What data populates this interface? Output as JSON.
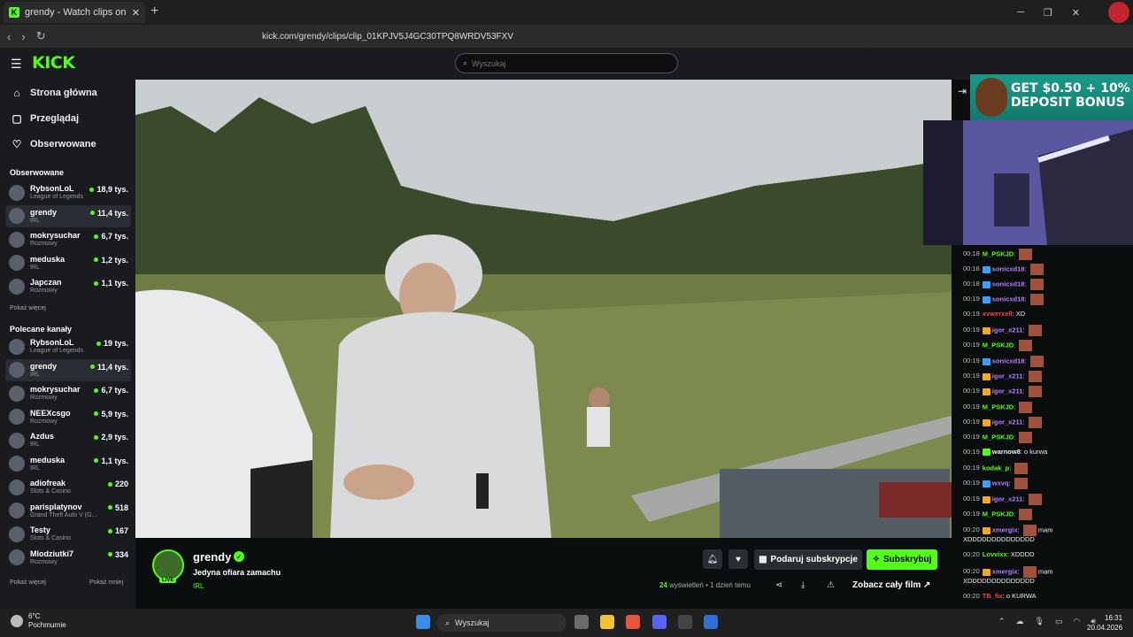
{
  "browser": {
    "tab_title": "grendy - Watch clips on Kick",
    "new_tab": "+",
    "url": "kick.com/grendy/clips/clip_01KPJV5J4GC30TPQ8WRDV53FXV",
    "win_min": "─",
    "win_max": "❐",
    "win_close": "✕"
  },
  "header": {
    "logo": "KICK",
    "search_placeholder": "Wyszukaj"
  },
  "sidebar": {
    "nav": [
      {
        "label": "Strona główna",
        "icon": "home-icon"
      },
      {
        "label": "Przeglądaj",
        "icon": "browse-icon"
      },
      {
        "label": "Obserwowane",
        "icon": "heart-icon"
      }
    ],
    "followed_heading": "Obserwowane",
    "followed": [
      {
        "name": "RybsonLoL",
        "category": "League of Legends",
        "viewers": "18,9 tys."
      },
      {
        "name": "grendy",
        "category": "IRL",
        "viewers": "11,4 tys."
      },
      {
        "name": "mokrysuchar",
        "category": "Rozmowy",
        "viewers": "6,7 tys."
      },
      {
        "name": "meduska",
        "category": "IRL",
        "viewers": "1,2 tys."
      },
      {
        "name": "Japczan",
        "category": "Rozmowy",
        "viewers": "1,1 tys."
      }
    ],
    "followed_more": "Pokaż więcej",
    "recommended_heading": "Polecane kanały",
    "recommended": [
      {
        "name": "RybsonLoL",
        "category": "League of Legends",
        "viewers": "19 tys."
      },
      {
        "name": "grendy",
        "category": "IRL",
        "viewers": "11,4 tys."
      },
      {
        "name": "mokrysuchar",
        "category": "Rozmowy",
        "viewers": "6,7 tys."
      },
      {
        "name": "NEEXcsgo",
        "category": "Rozmowy",
        "viewers": "5,9 tys."
      },
      {
        "name": "Azdus",
        "category": "IRL",
        "viewers": "2,9 tys."
      },
      {
        "name": "meduska",
        "category": "IRL",
        "viewers": "1,1 tys."
      },
      {
        "name": "adiofreak",
        "category": "Slots & Casino",
        "viewers": "220"
      },
      {
        "name": "parisplatynov",
        "category": "Grand Theft Auto V (G...",
        "viewers": "518"
      },
      {
        "name": "Testy",
        "category": "Slots & Casino",
        "viewers": "167"
      },
      {
        "name": "Mlodziutki7",
        "category": "Rozmowy",
        "viewers": "334"
      }
    ],
    "rec_more": "Pokaż więcej",
    "rec_less": "Pokaż mniej"
  },
  "clip": {
    "channel": "grendy",
    "live_badge": "LIVE",
    "verified": "✓",
    "title": "Jedyna ofiara zamachu",
    "category": "IRL",
    "gift_label": "Podaruj subskrypcje",
    "subscribe_label": "Subskrybuj",
    "views_count": "24",
    "views_label": "wyświetleń",
    "age": "• 1 dzień temu",
    "watch_full": "Zobacz cały film"
  },
  "ad": {
    "text": "GET $0.50 + 10% DEPOSIT BONUS"
  },
  "chat": [
    {
      "time": "00:18",
      "user": "M_PSKJD",
      "color": "#53fc18",
      "text": "",
      "emote": true,
      "badge": ""
    },
    {
      "time": "00:18",
      "user": "sonicxd18",
      "color": "#b47cff",
      "text": "",
      "emote": true,
      "badge": "#3aa0ff"
    },
    {
      "time": "00:18",
      "user": "sonicxd18",
      "color": "#b47cff",
      "text": "",
      "emote": true,
      "badge": "#3aa0ff"
    },
    {
      "time": "00:19",
      "user": "sonicxd18",
      "color": "#b47cff",
      "text": "",
      "emote": true,
      "badge": "#3aa0ff"
    },
    {
      "time": "00:19",
      "user": "xvwerxell",
      "color": "#ff4040",
      "text": "XD",
      "emote": false,
      "badge": ""
    },
    {
      "time": "00:19",
      "user": "igor_x211",
      "color": "#b47cff",
      "text": "",
      "emote": true,
      "badge": "#f5a623"
    },
    {
      "time": "00:19",
      "user": "M_PSKJD",
      "color": "#53fc18",
      "text": "",
      "emote": true,
      "badge": ""
    },
    {
      "time": "00:19",
      "user": "sonicxd18",
      "color": "#b47cff",
      "text": "",
      "emote": true,
      "badge": "#3aa0ff"
    },
    {
      "time": "00:19",
      "user": "igor_x211",
      "color": "#b47cff",
      "text": "",
      "emote": true,
      "badge": "#f5a623"
    },
    {
      "time": "00:19",
      "user": "igor_x211",
      "color": "#b47cff",
      "text": "",
      "emote": true,
      "badge": "#f5a623"
    },
    {
      "time": "00:19",
      "user": "M_PSKJD",
      "color": "#53fc18",
      "text": "",
      "emote": true,
      "badge": ""
    },
    {
      "time": "00:19",
      "user": "igor_x211",
      "color": "#b47cff",
      "text": "",
      "emote": true,
      "badge": "#f5a623"
    },
    {
      "time": "00:19",
      "user": "M_PSKJD",
      "color": "#53fc18",
      "text": "",
      "emote": true,
      "badge": ""
    },
    {
      "time": "00:19",
      "user": "warnow8",
      "color": "#eeeeee",
      "text": "o kurwa",
      "emote": false,
      "badge": "#53fc18"
    },
    {
      "time": "00:19",
      "user": "kodak_p",
      "color": "#53fc18",
      "text": "",
      "emote": true,
      "badge": ""
    },
    {
      "time": "00:19",
      "user": "wxvq",
      "color": "#b47cff",
      "text": "",
      "emote": true,
      "badge": "#3aa0ff"
    },
    {
      "time": "00:19",
      "user": "igor_x211",
      "color": "#b47cff",
      "text": "",
      "emote": true,
      "badge": "#f5a623"
    },
    {
      "time": "00:19",
      "user": "M_PSKJD",
      "color": "#53fc18",
      "text": "",
      "emote": true,
      "badge": ""
    },
    {
      "time": "00:20",
      "user": "xmergix",
      "color": "#b47cff",
      "text": "mam",
      "emote": true,
      "badge": "#f5a623"
    },
    {
      "time": "",
      "user": "",
      "color": "#eeeeee",
      "text": "XDDDDDDDDDDDDDD",
      "emote": false,
      "badge": ""
    },
    {
      "time": "00:20",
      "user": "Lovvixx",
      "color": "#53fc18",
      "text": "XDDDD",
      "emote": false,
      "badge": ""
    },
    {
      "time": "00:20",
      "user": "xmergix",
      "color": "#b47cff",
      "text": "mam",
      "emote": true,
      "badge": "#f5a623"
    },
    {
      "time": "",
      "user": "",
      "color": "#eeeeee",
      "text": "XDDDDDDDDDDDDDD",
      "emote": false,
      "badge": ""
    },
    {
      "time": "00:20",
      "user": "TB_fix",
      "color": "#ff4040",
      "text": "o KURWA",
      "emote": false,
      "badge": ""
    }
  ],
  "taskbar": {
    "temp": "6°C",
    "weather": "Pochmurnie",
    "search": "Wyszukaj",
    "time": "16:31",
    "date": "20.04.2026"
  },
  "colors": {
    "accent": "#53fc18",
    "panel": "#191b1f",
    "background": "#0b0e0f"
  }
}
